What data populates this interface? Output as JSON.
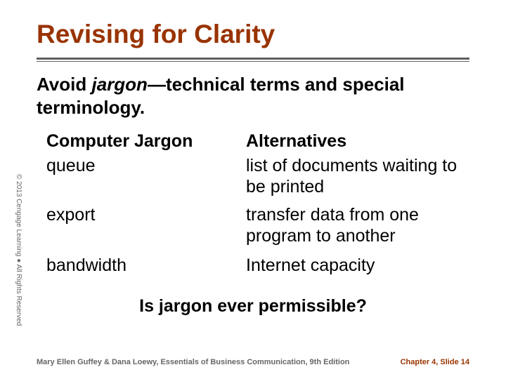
{
  "title": "Revising for Clarity",
  "subtitle_1": "Avoid ",
  "subtitle_em": "jargon",
  "subtitle_2": "—technical terms and special terminology.",
  "col_left_header": "Computer Jargon",
  "col_right_header": "Alternatives",
  "rows": [
    {
      "jargon": "queue",
      "alt": "list of documents waiting to be printed"
    },
    {
      "jargon": "export",
      "alt": "transfer data from one program to another"
    },
    {
      "jargon": "bandwidth",
      "alt": "Internet capacity"
    }
  ],
  "question": "Is jargon ever permissible?",
  "copyright": "© 2013 Cengage Learning ● All Rights Reserved",
  "footer_left": "Mary Ellen Guffey & Dana Loewy, Essentials of Business Communication, 9th Edition",
  "footer_right": "Chapter 4, Slide 14"
}
